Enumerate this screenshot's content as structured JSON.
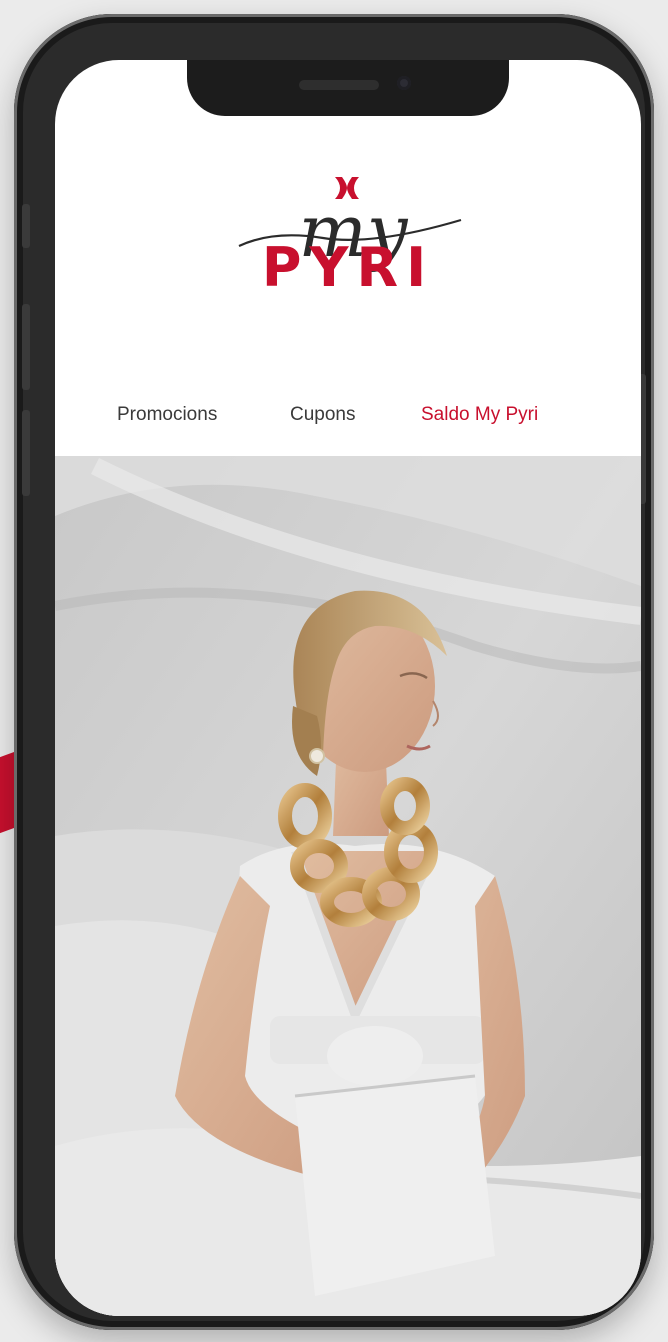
{
  "app": {
    "logo_script": "my",
    "logo_word": "PYRI",
    "brand_color": "#c8102e"
  },
  "tabs": [
    {
      "label": "Promocions",
      "active": false
    },
    {
      "label": "Cupons",
      "active": false
    },
    {
      "label": "Saldo My Pyri",
      "active": true
    }
  ],
  "colors": {
    "text_dark": "#3a3a3a",
    "accent": "#c8102e"
  },
  "icons": {
    "brand_mark": "pyri-x-mark-icon"
  }
}
